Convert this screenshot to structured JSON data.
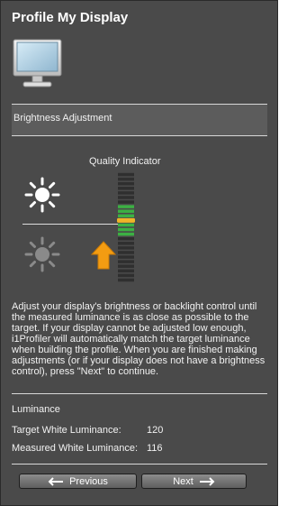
{
  "header": {
    "title": "Profile My Display"
  },
  "section": {
    "label": "Brightness Adjustment"
  },
  "quality_indicator": {
    "label": "Quality Indicator",
    "level": 0.55,
    "segment_count": 24,
    "green_segments": 6
  },
  "icons": {
    "monitor": "monitor-icon",
    "sun_bright": "sun-bright-icon",
    "sun_dim": "sun-dim-icon",
    "arrow": "arrow-up-icon",
    "prev_arrow": "arrow-left-icon",
    "next_arrow": "arrow-right-icon"
  },
  "colors": {
    "panel": "#4a4a4a",
    "accent_orange": "#f39c12",
    "meter_green": "#3cb043",
    "meter_marker": "#f0b428"
  },
  "description": "Adjust your display's brightness or backlight control until the measured luminance is as close as possible to the target.  If your display cannot be adjusted low enough, i1Profiler will automatically match the target luminance when building the profile.  When you are finished making adjustments (or if your display does not have a brightness control), press \"Next\" to continue.",
  "luminance": {
    "title": "Luminance",
    "target_label": "Target White Luminance:",
    "target_value": "120",
    "measured_label": "Measured White Luminance:",
    "measured_value": "116"
  },
  "nav": {
    "previous_label": "Previous",
    "next_label": "Next"
  }
}
